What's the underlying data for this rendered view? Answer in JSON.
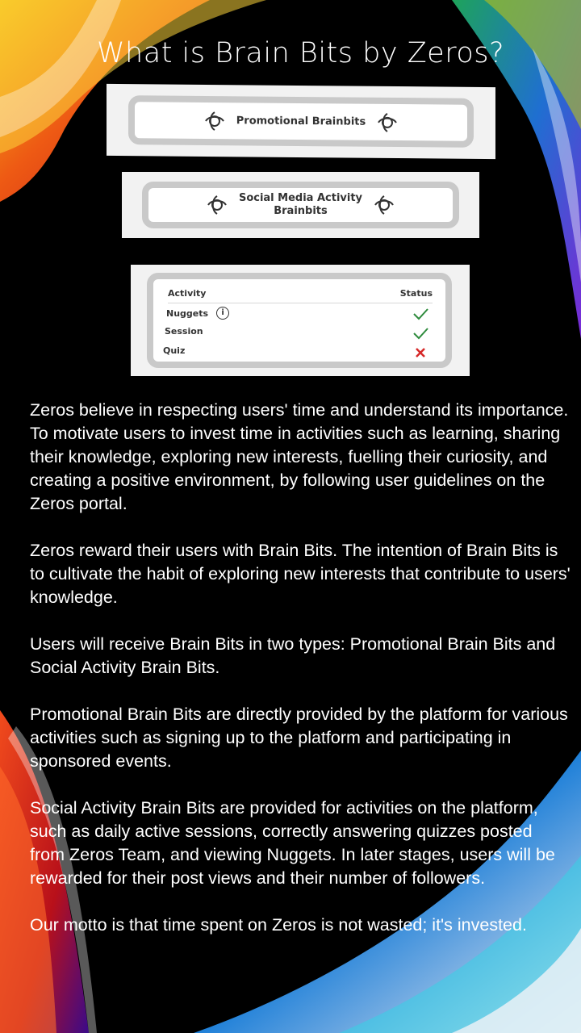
{
  "title": "What is Brain Bits by Zeros?",
  "cards": {
    "promotional_label": "Promotional Brainbits",
    "social_label_line1": "Social Media Activity",
    "social_label_line2": "Brainbits"
  },
  "table": {
    "col_activity": "Activity",
    "col_status": "Status",
    "rows": [
      {
        "activity": "Nuggets",
        "status": "check"
      },
      {
        "activity": "Session",
        "status": "check"
      },
      {
        "activity": "Quiz",
        "status": "cross"
      }
    ]
  },
  "paragraphs": [
    "Zeros believe in respecting users' time and understand its importance. To motivate users to invest time in activities such as learning, sharing their knowledge, exploring new interests, fuelling their curiosity, and creating a positive environment, by following user guidelines on the Zeros portal.",
    "Zeros reward their users with Brain Bits. The intention of Brain Bits is to cultivate the habit of exploring new interests that contribute to users' knowledge.",
    "Users will receive Brain Bits in two types: Promotional Brain Bits and Social Activity Brain Bits.",
    "Promotional Brain Bits are directly provided by the platform for various activities such as signing up to the platform and participating in sponsored events.",
    "Social Activity Brain Bits are provided for activities on the platform, such as daily active sessions, correctly answering quizzes posted from Zeros Team, and viewing Nuggets. In later stages, users will be rewarded for their post views and their number of followers.",
    "Our motto is that time spent on Zeros is not wasted; it's invested."
  ],
  "colors": {
    "background": "#000000",
    "check": "#2e8b3d",
    "cross": "#d62828"
  }
}
